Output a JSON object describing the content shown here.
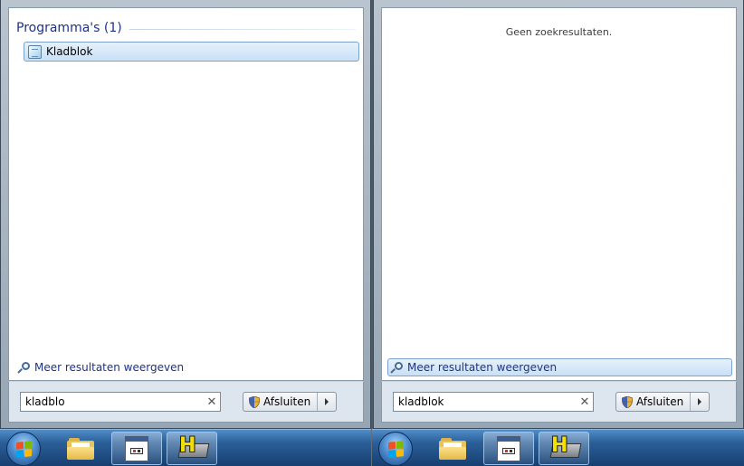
{
  "left_menu": {
    "section_header": "Programma's (1)",
    "results": [
      {
        "label": "Kladblok",
        "icon": "notepad-icon"
      }
    ],
    "more_results": "Meer resultaten weergeven",
    "search": {
      "value": "kladblo"
    },
    "shutdown_label": "Afsluiten"
  },
  "right_menu": {
    "no_results": "Geen zoekresultaten.",
    "more_results": "Meer resultaten weergeven",
    "search": {
      "value": "kladblok"
    },
    "shutdown_label": "Afsluiten"
  },
  "taskbar": {
    "items": [
      {
        "name": "windows-explorer",
        "icon": "folder-icon"
      },
      {
        "name": "application-window",
        "icon": "app-window-icon"
      },
      {
        "name": "h-application",
        "icon": "h-app-icon"
      }
    ]
  },
  "colors": {
    "accent_text": "#1e3287",
    "highlight_border": "#7da2ce",
    "taskbar_top": "#4f8dc9",
    "taskbar_bottom": "#173f70"
  }
}
